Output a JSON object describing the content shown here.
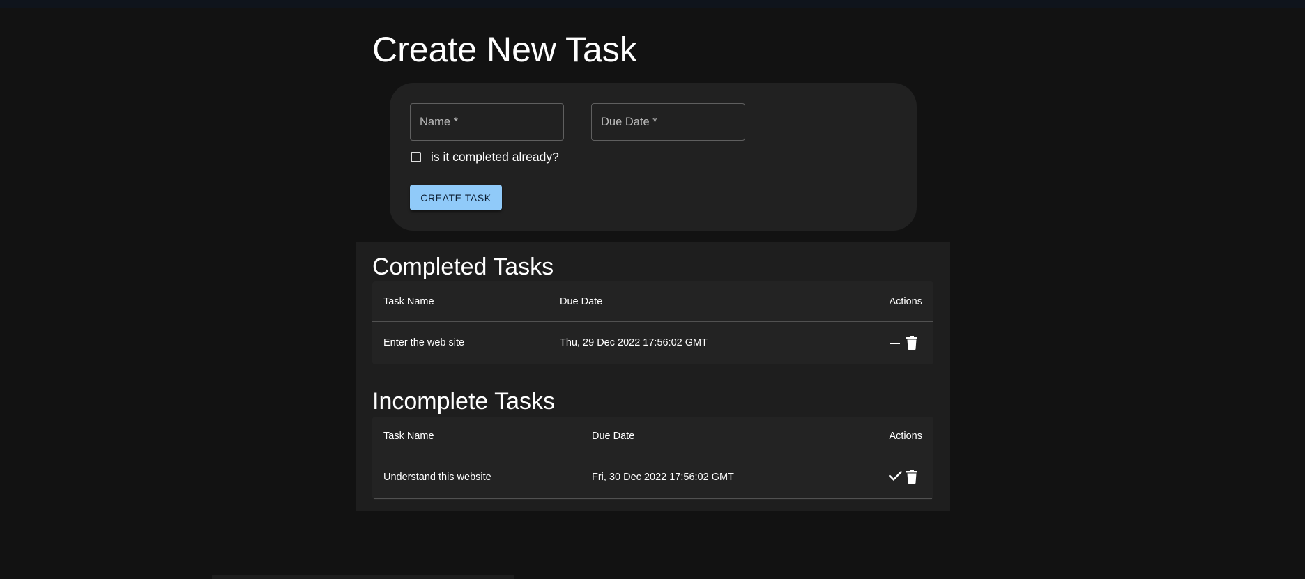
{
  "form": {
    "title": "Create New Task",
    "name_label": "Name *",
    "due_date_label": "Due Date *",
    "checkbox_label": "is it completed already?",
    "submit_label": "CREATE TASK"
  },
  "completed": {
    "title": "Completed Tasks",
    "columns": [
      "Task Name",
      "Due Date",
      "Actions"
    ],
    "rows": [
      {
        "name": "Enter the web site",
        "due_date": "Thu, 29 Dec 2022 17:56:02 GMT",
        "actions": [
          "minus-icon",
          "trash-icon"
        ]
      }
    ]
  },
  "incomplete": {
    "title": "Incomplete Tasks",
    "columns": [
      "Task Name",
      "Due Date",
      "Actions"
    ],
    "rows": [
      {
        "name": "Understand this website",
        "due_date": "Fri, 30 Dec 2022 17:56:02 GMT",
        "actions": [
          "check-icon",
          "trash-icon"
        ]
      }
    ]
  },
  "colors": {
    "background": "#121212",
    "card": "#212121",
    "accent": "#90caf9"
  }
}
